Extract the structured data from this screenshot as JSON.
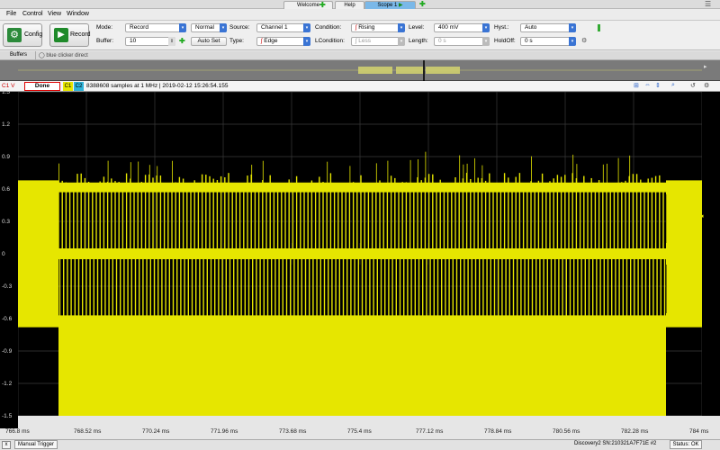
{
  "tabs": [
    {
      "label": "Welcome"
    },
    {
      "label": "Help"
    },
    {
      "label": "Scope 1"
    }
  ],
  "menu": [
    "File",
    "Control",
    "View",
    "Window"
  ],
  "toolbar": {
    "config_label": "Config",
    "record_label": "Record",
    "mode_label": "Mode:",
    "mode_value": "Record",
    "trigger_mode_value": "Normal",
    "source_label": "Source:",
    "source_value": "Channel 1",
    "condition_label": "Condition:",
    "condition_value": "Rising",
    "level_label": "Level:",
    "level_value": "400 mV",
    "hyst_label": "Hyst.:",
    "hyst_value": "Auto",
    "buffer_label": "Buffer:",
    "buffer_value": "10",
    "autoset_label": "Auto Set",
    "type_label": "Type:",
    "type_value": "Edge",
    "lcondition_label": "LCondition:",
    "lcondition_value": "Less",
    "length_label": "Length:",
    "length_value": "0 s",
    "holdoff_label": "HoldOff:",
    "holdoff_value": "0 s"
  },
  "buffers": {
    "label": "Buffers",
    "item": "blue clicker direct"
  },
  "status": {
    "channel_label": "C1 V",
    "state": "Done",
    "c1": "C1",
    "c2": "C2",
    "info": "8388608 samples at 1 MHz | 2019-02-12 15:26:54.155"
  },
  "plot": {
    "y_ticks": [
      "1.5",
      "1.2",
      "0.9",
      "0.6",
      "0.3",
      "0",
      "-0.3",
      "-0.6",
      "-0.9",
      "-1.2",
      "-1.5"
    ],
    "x_ticks": [
      "766.8 ms",
      "768.52 ms",
      "770.24 ms",
      "771.96 ms",
      "773.68 ms",
      "775.4 ms",
      "777.12 ms",
      "778.84 ms",
      "780.56 ms",
      "782.28 ms",
      "784 ms"
    ],
    "trace_color": "#e6e600",
    "background": "#000000"
  },
  "footer": {
    "left_label": "Manual Trigger",
    "device": "Discovery2 SN:210321A7F71E #2",
    "status": "Status: OK"
  }
}
